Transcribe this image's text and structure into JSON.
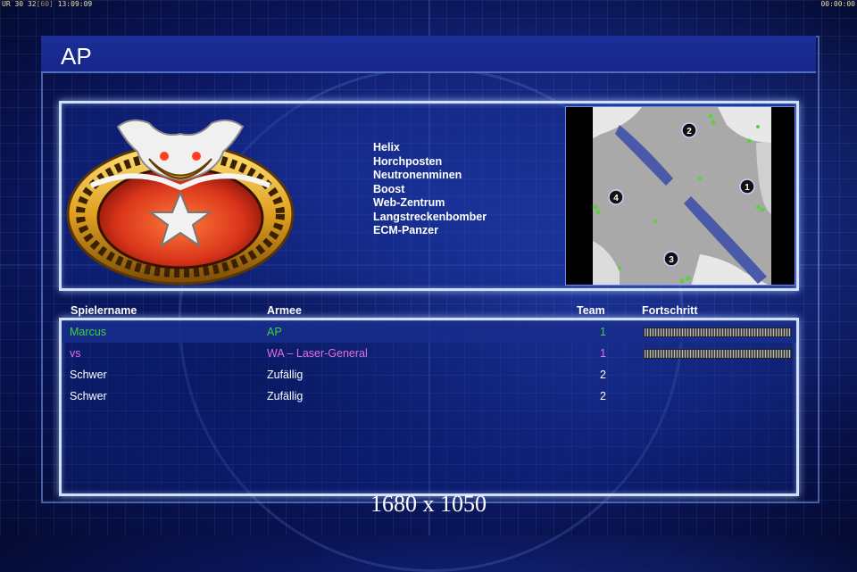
{
  "hud": {
    "left_a": "UR",
    "left_b": "30",
    "left_c": "32",
    "left_d": "[60]",
    "left_time": "13:09:09",
    "right_timer": "00:00:00"
  },
  "screen": {
    "title": "AP",
    "resolution_label": "1680 x 1050"
  },
  "general_powers": [
    "Helix",
    "Horchposten",
    "Neutronenminen",
    "Boost",
    "Web-Zentrum",
    "Langstreckenbomber",
    "ECM-Panzer"
  ],
  "minimap": {
    "start_positions": [
      "1",
      "2",
      "3",
      "4"
    ]
  },
  "columns": {
    "player": "Spielername",
    "army": "Armee",
    "team": "Team",
    "progress": "Fortschritt"
  },
  "players": [
    {
      "name": "Marcus",
      "army": "AP",
      "team": "1",
      "color": "#39d639",
      "progress_shown": true
    },
    {
      "name": "vs",
      "army": "WA – Laser-General",
      "team": "1",
      "color": "#e070e0",
      "progress_shown": true
    },
    {
      "name": "Schwer",
      "army": "Zufällig",
      "team": "2",
      "color": "#ffffff",
      "progress_shown": false
    },
    {
      "name": "Schwer",
      "army": "Zufällig",
      "team": "2",
      "color": "#ffffff",
      "progress_shown": false
    }
  ]
}
